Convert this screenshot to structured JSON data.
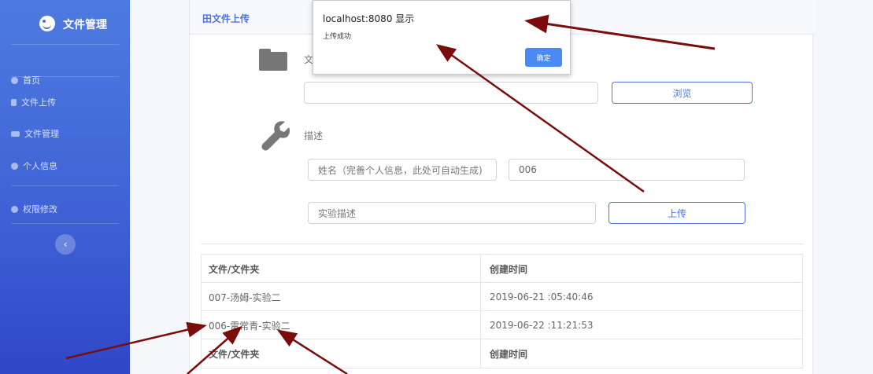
{
  "sidebar": {
    "brand": "文件管理",
    "items": [
      {
        "label": "首页"
      },
      {
        "label": "文件上传"
      },
      {
        "label": "文件管理"
      },
      {
        "label": "个人信息"
      },
      {
        "label": "权限修改"
      }
    ],
    "collapse_glyph": "‹"
  },
  "card": {
    "title": "田文件上传",
    "file_label": "文件",
    "file_input_value": "",
    "browse_label": "浏览",
    "desc_label": "描述",
    "name_placeholder": "姓名（完善个人信息，此处可自动生成)",
    "id_value": "006",
    "desc_placeholder": "实验描述",
    "upload_label": "上传"
  },
  "table": {
    "headers": [
      "文件/文件夹",
      "创建时间"
    ],
    "rows": [
      [
        "007-汤姆-实验二",
        "2019-06-21 :05:40:46"
      ],
      [
        "006-雷常青-实验二",
        "2019-06-22 :11:21:53"
      ]
    ],
    "footer": [
      "文件/文件夹",
      "创建时间"
    ]
  },
  "dialog": {
    "host": "localhost:8080 显示",
    "message": "上传成功",
    "ok_label": "确定"
  },
  "colors": {
    "accent": "#4e73df",
    "sidebar_top": "#4d7be0",
    "sidebar_bottom": "#2f47c8",
    "arrow": "#8b0a0a",
    "dialog_button": "#4a8af4"
  }
}
